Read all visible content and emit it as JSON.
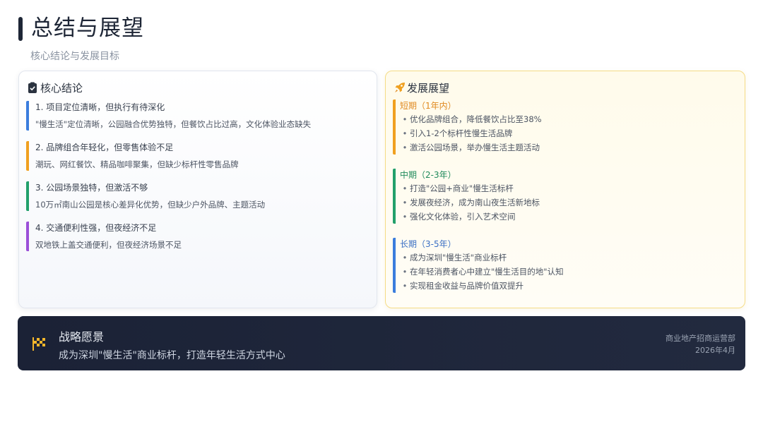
{
  "header": {
    "title": "总结与展望",
    "subtitle": "核心结论与发展目标"
  },
  "conclusions": {
    "title": "核心结论",
    "icon": "clipboard-icon",
    "items": [
      {
        "head": "1. 项目定位清晰，但执行有待深化",
        "body": "\"慢生活\"定位清晰，公园融合优势独特，但餐饮占比过高，文化体验业态缺失",
        "color": "#3b7ddd"
      },
      {
        "head": "2. 品牌组合年轻化，但零售体验不足",
        "body": "潮玩、网红餐饮、精品咖啡聚集，但缺少标杆性零售品牌",
        "color": "#f0a020"
      },
      {
        "head": "3. 公园场景独特，但激活不够",
        "body": "10万㎡南山公园是核心差异化优势，但缺少户外品牌、主题活动",
        "color": "#22a06b"
      },
      {
        "head": "4. 交通便利性强，但夜经济不足",
        "body": "双地铁上盖交通便利，但夜经济场景不足",
        "color": "#9b4fd8"
      }
    ]
  },
  "outlook": {
    "title": "发展展望",
    "icon": "rocket-icon",
    "periods": [
      {
        "label": "短期（1年内）",
        "color": "#f0a020",
        "label_color": "#e08a20",
        "bullets": [
          "优化品牌组合，降低餐饮占比至38%",
          "引入1-2个标杆性慢生活品牌",
          "激活公园场景，举办慢生活主题活动"
        ]
      },
      {
        "label": "中期（2-3年）",
        "color": "#22a06b",
        "label_color": "#1f8a5b",
        "bullets": [
          "打造\"公园+商业\"慢生活标杆",
          "发展夜经济，成为南山夜生活新地标",
          "强化文化体验，引入艺术空间"
        ]
      },
      {
        "label": "长期（3-5年）",
        "color": "#3b7ddd",
        "label_color": "#3b6fc4",
        "bullets": [
          "成为深圳\"慢生活\"商业标杆",
          "在年轻消费者心中建立\"慢生活目的地\"认知",
          "实现租金收益与品牌价值双提升"
        ]
      }
    ]
  },
  "vision": {
    "icon": "checkered-flag-icon",
    "title": "战略愿景",
    "text": "成为深圳\"慢生活\"商业标杆，打造年轻生活方式中心",
    "department": "商业地产招商运营部",
    "date": "2026年4月"
  }
}
